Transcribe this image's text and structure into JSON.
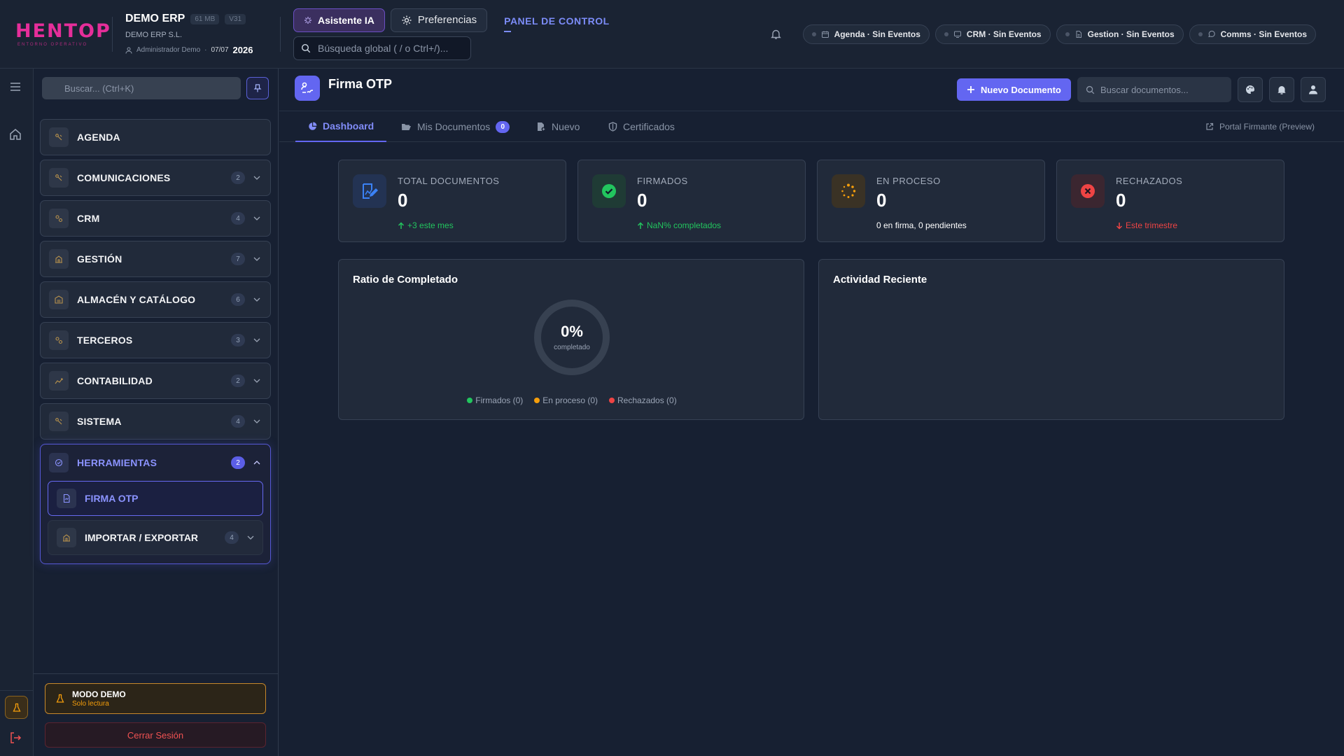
{
  "brand": {
    "logo": "HENTOP",
    "tagline": "ENTORNO OPERATIVO"
  },
  "company": {
    "name": "DEMO ERP",
    "size_badge": "61 MB",
    "version_badge": "V31",
    "legal_name": "DEMO ERP S.L.",
    "user": "Administrador Demo",
    "date": "07/07",
    "year": "2026"
  },
  "toolbar": {
    "ai_label": "Asistente IA",
    "prefs_label": "Preferencias",
    "global_search_placeholder": "Búsqueda global ( / o Ctrl+/)...",
    "panel_link": "PANEL DE CONTROL"
  },
  "events": [
    {
      "label": "Agenda · Sin Eventos",
      "icon": "calendar-icon"
    },
    {
      "label": "CRM · Sin Eventos",
      "icon": "monitor-icon"
    },
    {
      "label": "Gestion · Sin Eventos",
      "icon": "document-icon"
    },
    {
      "label": "Comms · Sin Eventos",
      "icon": "chat-icon"
    }
  ],
  "sidebar": {
    "search_placeholder": "Buscar... (Ctrl+K)",
    "items": [
      {
        "label": "AGENDA",
        "count": ""
      },
      {
        "label": "COMUNICACIONES",
        "count": "2"
      },
      {
        "label": "CRM",
        "count": "4"
      },
      {
        "label": "GESTIÓN",
        "count": "7"
      },
      {
        "label": "ALMACÉN Y CATÁLOGO",
        "count": "6"
      },
      {
        "label": "TERCEROS",
        "count": "3"
      },
      {
        "label": "CONTABILIDAD",
        "count": "2"
      },
      {
        "label": "SISTEMA",
        "count": "4"
      }
    ],
    "group": {
      "label": "HERRAMIENTAS",
      "count": "2",
      "children": [
        {
          "label": "FIRMA OTP",
          "count": ""
        },
        {
          "label": "IMPORTAR / EXPORTAR",
          "count": "4"
        }
      ]
    },
    "demo_title": "MODO DEMO",
    "demo_sub": "Solo lectura",
    "logout_label": "Cerrar Sesión"
  },
  "main": {
    "app_title": "Firma OTP",
    "new_doc_label": "Nuevo Documento",
    "doc_search_placeholder": "Buscar documentos...",
    "tabs": [
      {
        "label": "Dashboard",
        "badge": ""
      },
      {
        "label": "Mis Documentos",
        "badge": "0"
      },
      {
        "label": "Nuevo",
        "badge": ""
      },
      {
        "label": "Certificados",
        "badge": ""
      }
    ],
    "portal_label": "Portal Firmante (Preview)",
    "stats": [
      {
        "label": "TOTAL DOCUMENTOS",
        "value": "0",
        "sub": "+3 este mes",
        "sub_color": "#22c55e",
        "icon": "edit-document-icon",
        "accent": "#3b82f6"
      },
      {
        "label": "FIRMADOS",
        "value": "0",
        "sub": "NaN% completados",
        "sub_color": "#22c55e",
        "icon": "check-circle-icon",
        "accent": "#22c55e"
      },
      {
        "label": "EN PROCESO",
        "value": "0",
        "sub": "0 en firma, 0 pendientes",
        "sub_color": "#ffffff",
        "icon": "spinner-icon",
        "accent": "#f59e0b"
      },
      {
        "label": "RECHAZADOS",
        "value": "0",
        "sub": "Este trimestre",
        "sub_color": "#ef4444",
        "icon": "x-circle-icon",
        "accent": "#ef4444"
      }
    ],
    "ratio": {
      "title": "Ratio de Completado",
      "percent": "0%",
      "caption": "completado",
      "legend": [
        {
          "label": "Firmados (0)",
          "color": "#22c55e"
        },
        {
          "label": "En proceso (0)",
          "color": "#f59e0b"
        },
        {
          "label": "Rechazados (0)",
          "color": "#ef4444"
        }
      ]
    },
    "activity_title": "Actividad Reciente"
  },
  "colors": {
    "accent": "#6366f1",
    "brand": "#e62e9a",
    "warning": "#f59e0b",
    "danger": "#f05252"
  }
}
